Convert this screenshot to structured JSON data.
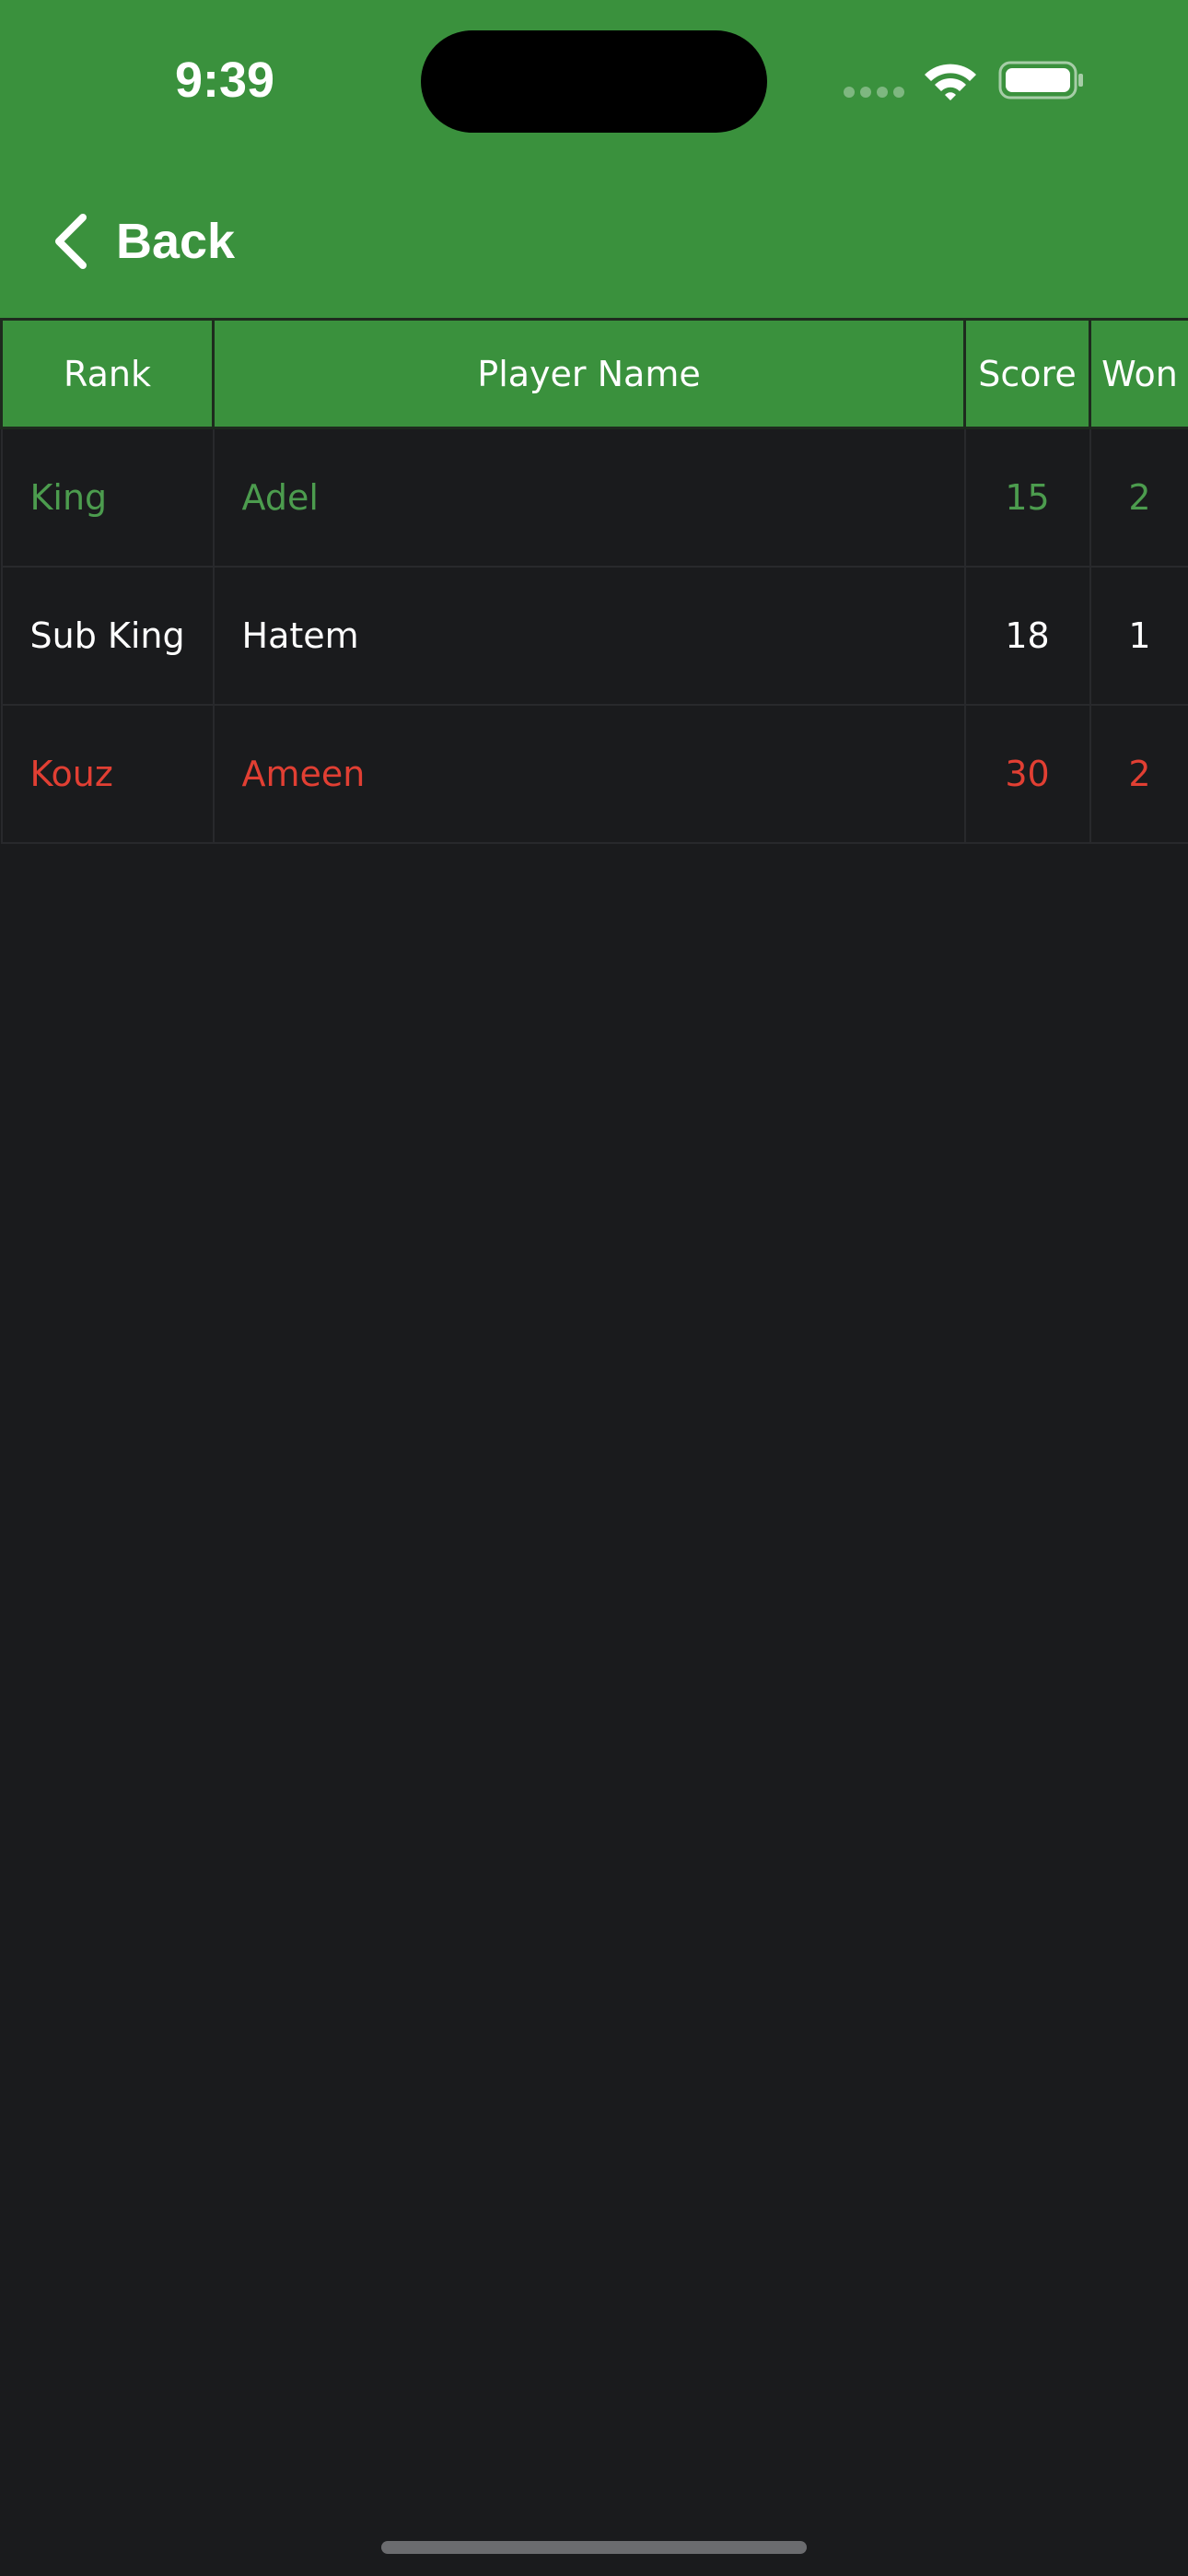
{
  "status_bar": {
    "time": "9:39"
  },
  "nav": {
    "back_label": "Back",
    "back_icon": "chevron-left-icon"
  },
  "colors": {
    "header_green": "#3a913d",
    "background": "#1a1b1d",
    "rank_king": "#4c9c4e",
    "rank_sub_king": "#ffffff",
    "rank_kouz": "#e13f33"
  },
  "table": {
    "headers": [
      "Rank",
      "Player Name",
      "Score",
      "Won"
    ],
    "rows": [
      {
        "rank": "King",
        "player": "Adel",
        "score": "15",
        "won": "2",
        "color": "#4c9c4e"
      },
      {
        "rank": "Sub King",
        "player": "Hatem",
        "score": "18",
        "won": "1",
        "color": "#ffffff"
      },
      {
        "rank": "Kouz",
        "player": "Ameen",
        "score": "30",
        "won": "2",
        "color": "#e13f33"
      }
    ]
  }
}
